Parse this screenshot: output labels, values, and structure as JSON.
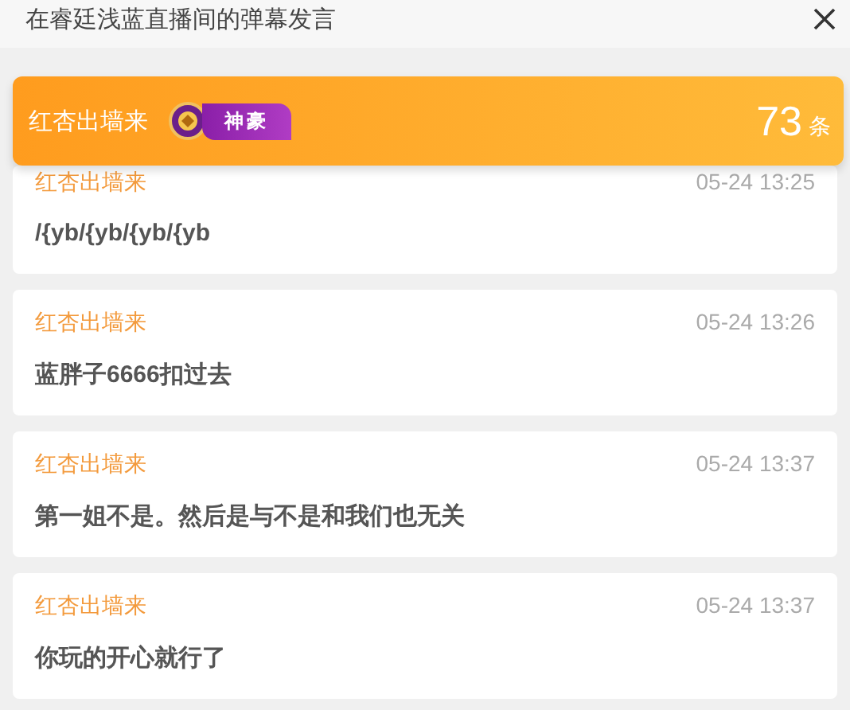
{
  "dialog": {
    "title": "在睿廷浅蓝直播间的弹幕发言"
  },
  "summary": {
    "user": "红杏出墙来",
    "badge": "神豪",
    "count": "73",
    "count_unit": "条"
  },
  "messages": [
    {
      "user": "红杏出墙来",
      "time": "05-24 13:25",
      "text": "/{yb/{yb/{yb/{yb"
    },
    {
      "user": "红杏出墙来",
      "time": "05-24 13:26",
      "text": "蓝胖子6666扣过去"
    },
    {
      "user": "红杏出墙来",
      "time": "05-24 13:37",
      "text": "第一姐不是。然后是与不是和我们也无关"
    },
    {
      "user": "红杏出墙来",
      "time": "05-24 13:37",
      "text": "你玩的开心就行了"
    }
  ]
}
